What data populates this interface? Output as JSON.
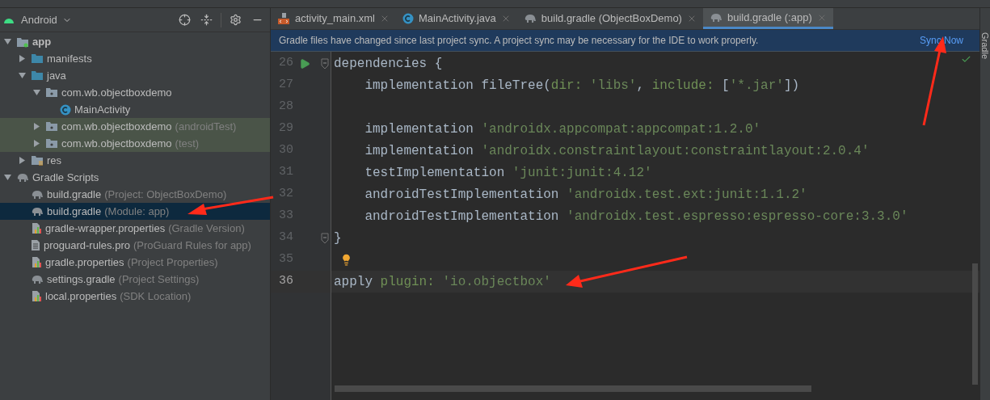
{
  "project_panel": {
    "view": "Android",
    "tree": [
      {
        "label": "app",
        "kind": "module",
        "bold": true,
        "expanded": true,
        "selected": false,
        "highlighted": false,
        "children": [
          {
            "label": "manifests",
            "kind": "folder",
            "bold": false,
            "expanded": false,
            "selected": false,
            "highlighted": false
          },
          {
            "label": "java",
            "kind": "folder",
            "bold": false,
            "expanded": true,
            "selected": false,
            "highlighted": false,
            "children": [
              {
                "label": "com.wb.objectboxdemo",
                "kind": "package",
                "bold": false,
                "expanded": true,
                "selected": false,
                "highlighted": false,
                "children": [
                  {
                    "label": "MainActivity",
                    "kind": "class",
                    "bold": false,
                    "selected": false,
                    "highlighted": false
                  }
                ]
              },
              {
                "label": "com.wb.objectboxdemo",
                "hint": "(androidTest)",
                "kind": "package",
                "bold": false,
                "expanded": false,
                "selected": false,
                "highlighted": true
              },
              {
                "label": "com.wb.objectboxdemo",
                "hint": "(test)",
                "kind": "package",
                "bold": false,
                "expanded": false,
                "selected": false,
                "highlighted": true
              }
            ]
          },
          {
            "label": "res",
            "kind": "res",
            "bold": false,
            "expanded": false,
            "selected": false,
            "highlighted": false
          }
        ]
      },
      {
        "label": "Gradle Scripts",
        "kind": "gradle",
        "bold": false,
        "expanded": true,
        "selected": false,
        "highlighted": false,
        "children": [
          {
            "label": "build.gradle",
            "hint": "(Project: ObjectBoxDemo)",
            "kind": "gradle",
            "bold": false,
            "selected": false,
            "highlighted": false
          },
          {
            "label": "build.gradle",
            "hint": "(Module: app)",
            "kind": "gradle",
            "bold": false,
            "selected": true,
            "highlighted": false
          },
          {
            "label": "gradle-wrapper.properties",
            "hint": "(Gradle Version)",
            "kind": "properties",
            "bold": false,
            "selected": false,
            "highlighted": false
          },
          {
            "label": "proguard-rules.pro",
            "hint": "(ProGuard Rules for app)",
            "kind": "file",
            "bold": false,
            "selected": false,
            "highlighted": false
          },
          {
            "label": "gradle.properties",
            "hint": "(Project Properties)",
            "kind": "properties",
            "bold": false,
            "selected": false,
            "highlighted": false
          },
          {
            "label": "settings.gradle",
            "hint": "(Project Settings)",
            "kind": "gradle",
            "bold": false,
            "selected": false,
            "highlighted": false
          },
          {
            "label": "local.properties",
            "hint": "(SDK Location)",
            "kind": "properties",
            "bold": false,
            "selected": false,
            "highlighted": false
          }
        ]
      }
    ]
  },
  "tabs": [
    {
      "label": "activity_main.xml",
      "kind": "xml",
      "selected": false
    },
    {
      "label": "MainActivity.java",
      "kind": "class",
      "selected": false
    },
    {
      "label": "build.gradle (ObjectBoxDemo)",
      "kind": "gradle",
      "selected": false
    },
    {
      "label": "build.gradle (:app)",
      "kind": "gradle",
      "selected": true
    }
  ],
  "banner": {
    "message": "Gradle files have changed since last project sync. A project sync may be necessary for the IDE to work properly.",
    "action": "Sync Now"
  },
  "editor": {
    "lines": [
      {
        "number": "26",
        "kind": "run",
        "fold": true,
        "current": false,
        "tokens": [
          {
            "text": "dependencies {",
            "kind": "plain"
          }
        ]
      },
      {
        "number": "27",
        "kind": "code",
        "fold": false,
        "current": false,
        "tokens": [
          {
            "text": "    implementation fileTree(",
            "kind": "plain"
          },
          {
            "text": "dir:",
            "kind": "label"
          },
          {
            "text": " 'libs'",
            "kind": "string"
          },
          {
            "text": ", ",
            "kind": "plain"
          },
          {
            "text": "include:",
            "kind": "label"
          },
          {
            "text": " [",
            "kind": "plain"
          },
          {
            "text": "'*.jar'",
            "kind": "string"
          },
          {
            "text": "])",
            "kind": "plain"
          }
        ]
      },
      {
        "number": "28",
        "kind": "code",
        "fold": false,
        "current": false
      },
      {
        "number": "29",
        "kind": "code",
        "fold": false,
        "current": false,
        "tokens": [
          {
            "text": "    implementation ",
            "kind": "plain"
          },
          {
            "text": "'androidx.appcompat:appcompat:1.2.0'",
            "kind": "string"
          }
        ]
      },
      {
        "number": "30",
        "kind": "code",
        "fold": false,
        "current": false,
        "tokens": [
          {
            "text": "    implementation ",
            "kind": "plain"
          },
          {
            "text": "'androidx.constraintlayout:constraintlayout:2.0.4'",
            "kind": "string"
          }
        ]
      },
      {
        "number": "31",
        "kind": "code",
        "fold": false,
        "current": false,
        "tokens": [
          {
            "text": "    testImplementation ",
            "kind": "plain"
          },
          {
            "text": "'junit:junit:4.12'",
            "kind": "string"
          }
        ]
      },
      {
        "number": "32",
        "kind": "code",
        "fold": false,
        "current": false,
        "tokens": [
          {
            "text": "    androidTestImplementation ",
            "kind": "plain"
          },
          {
            "text": "'androidx.test.ext:junit:1.1.2'",
            "kind": "string"
          }
        ]
      },
      {
        "number": "33",
        "kind": "code",
        "fold": false,
        "current": false,
        "tokens": [
          {
            "text": "    androidTestImplementation ",
            "kind": "plain"
          },
          {
            "text": "'androidx.test.espresso:espresso-core:3.3.0'",
            "kind": "string"
          }
        ]
      },
      {
        "number": "34",
        "kind": "code",
        "fold": true,
        "current": false,
        "tokens": [
          {
            "text": "}",
            "kind": "plain"
          }
        ]
      },
      {
        "number": "35",
        "kind": "bulb",
        "fold": false,
        "current": false
      },
      {
        "number": "36",
        "kind": "code",
        "fold": false,
        "current": true,
        "tokens": [
          {
            "text": "apply ",
            "kind": "plain"
          },
          {
            "text": "plugin:",
            "kind": "label"
          },
          {
            "text": " 'io.objectbox'",
            "kind": "string"
          }
        ]
      }
    ]
  },
  "side_tool": {
    "label": "Gradle"
  }
}
